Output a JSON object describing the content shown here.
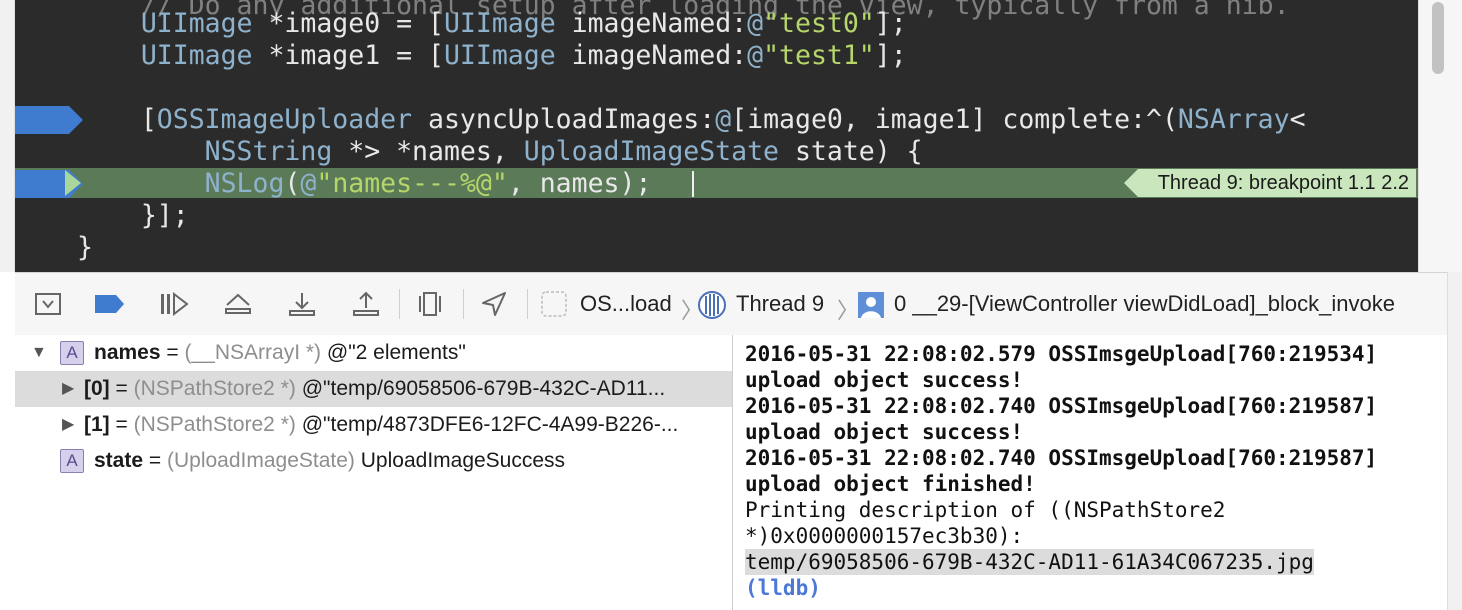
{
  "editor": {
    "lines": [
      {
        "parts": [
          [
            "cm",
            "    // Do any additional setup after loading the view, typically from a nib."
          ]
        ]
      },
      {
        "parts": [
          [
            "pn",
            "    "
          ],
          [
            "cls",
            "UIImage"
          ],
          [
            "pn",
            " *image0 = ["
          ],
          [
            "cls",
            "UIImage"
          ],
          [
            "pn",
            " imageNamed:"
          ],
          [
            "at",
            "@"
          ],
          [
            "str",
            "\"test0\""
          ],
          [
            "pn",
            "];"
          ]
        ]
      },
      {
        "parts": [
          [
            "pn",
            "    "
          ],
          [
            "cls",
            "UIImage"
          ],
          [
            "pn",
            " *image1 = ["
          ],
          [
            "cls",
            "UIImage"
          ],
          [
            "pn",
            " imageNamed:"
          ],
          [
            "at",
            "@"
          ],
          [
            "str",
            "\"test1\""
          ],
          [
            "pn",
            "];"
          ]
        ]
      },
      {
        "parts": [
          [
            "pn",
            ""
          ]
        ]
      },
      {
        "parts": [
          [
            "pn",
            "    ["
          ],
          [
            "cls",
            "OSSImageUploader"
          ],
          [
            "pn",
            " asyncUploadImages:"
          ],
          [
            "at",
            "@"
          ],
          [
            "pn",
            "[image0, image1] complete:^("
          ],
          [
            "cls",
            "NSArray"
          ],
          [
            "pn",
            "<"
          ]
        ]
      },
      {
        "parts": [
          [
            "pn",
            "        "
          ],
          [
            "cls",
            "NSString"
          ],
          [
            "pn",
            " *> *names, "
          ],
          [
            "cls",
            "UploadImageState"
          ],
          [
            "pn",
            " state) {"
          ]
        ]
      },
      {
        "parts": [
          [
            "pn",
            "        "
          ],
          [
            "kw",
            "NSLog"
          ],
          [
            "pn",
            "("
          ],
          [
            "at",
            "@"
          ],
          [
            "str",
            "\"names---%@\""
          ],
          [
            "pn",
            ", names);"
          ]
        ]
      },
      {
        "parts": [
          [
            "pn",
            "    }];"
          ]
        ]
      },
      {
        "parts": [
          [
            "pn",
            "}"
          ]
        ]
      }
    ],
    "breakpoint_badge": "Thread 9: breakpoint 1.1 2.2"
  },
  "debugbar": {
    "icons": [
      "hide-debug-area-icon",
      "breakpoints-toggle-icon",
      "continue-icon",
      "step-over-icon",
      "step-into-icon",
      "step-out-icon",
      "view-hierarchy-icon",
      "simulate-location-icon"
    ],
    "crumb_process": "OS...load",
    "crumb_thread": "Thread 9",
    "crumb_frame": "0 __29-[ViewController viewDidLoad]_block_invoke"
  },
  "variables": [
    {
      "name": "names",
      "type": "(__NSArrayI *)",
      "value": "@\"2 elements\"",
      "expanded": true,
      "badge": "A"
    },
    {
      "name": "[0]",
      "type": "(NSPathStore2 *)",
      "value": "@\"temp/69058506-679B-432C-AD11...",
      "selected": true
    },
    {
      "name": "[1]",
      "type": "(NSPathStore2 *)",
      "value": "@\"temp/4873DFE6-12FC-4A99-B226-..."
    },
    {
      "name": "state",
      "type": "(UploadImageState)",
      "value": "UploadImageSuccess",
      "badge": "A"
    }
  ],
  "console": {
    "lines": [
      "2016-05-31 22:08:02.579 OSSImsgeUpload[760:219534]",
      "upload object success!",
      "2016-05-31 22:08:02.740 OSSImsgeUpload[760:219587]",
      "upload object success!",
      "2016-05-31 22:08:02.740 OSSImsgeUpload[760:219587]",
      "upload object finished!",
      "Printing description of ((NSPathStore2",
      "*)0x0000000157ec3b30):",
      "temp/69058506-679B-432C-AD11-61A34C067235.jpg"
    ],
    "prompt": "(lldb)"
  }
}
